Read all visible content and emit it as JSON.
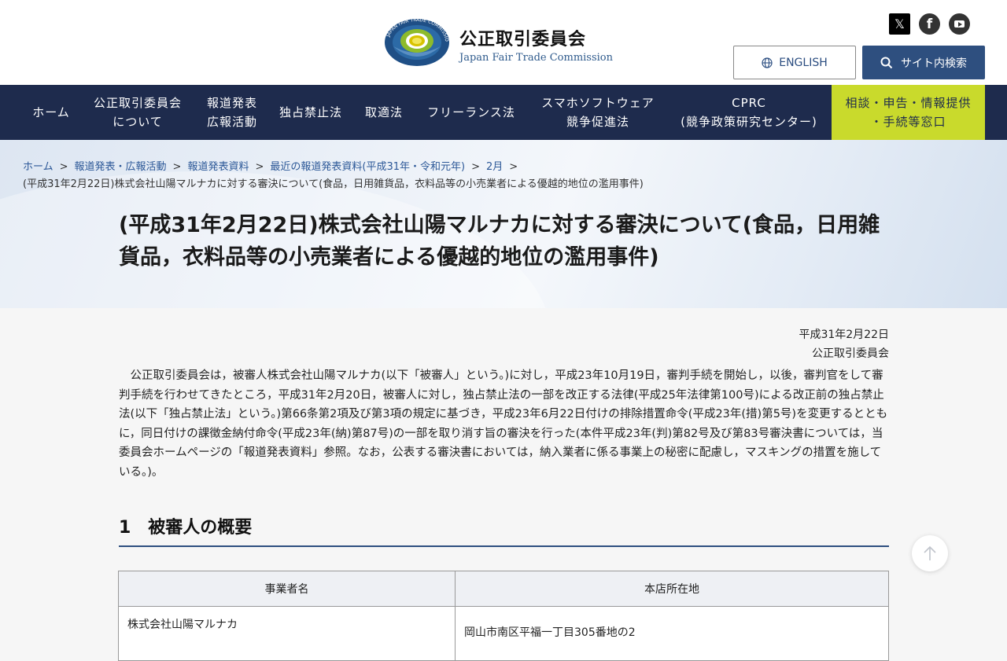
{
  "header": {
    "title": "公正取引委員会",
    "subtitle": "Japan Fair Trade Commission",
    "logo_ring_text": "JAPAN FAIR TRADE COMMISSION",
    "english_label": "ENGLISH",
    "search_label": "サイト内検索",
    "social": {
      "x": "𝕏",
      "facebook": "f"
    }
  },
  "nav": {
    "items": [
      {
        "label": "ホーム"
      },
      {
        "label": "公正取引委員会\nについて"
      },
      {
        "label": "報道発表\n広報活動"
      },
      {
        "label": "独占禁止法"
      },
      {
        "label": "取適法"
      },
      {
        "label": "フリーランス法"
      },
      {
        "label": "スマホソフトウェア\n競争促進法"
      },
      {
        "label": "CPRC\n(競争政策研究センター)"
      },
      {
        "label": "相談・申告・情報提供\n・手続等窓口"
      }
    ]
  },
  "breadcrumb": {
    "items": [
      "ホーム",
      "報道発表・広報活動",
      "報道発表資料",
      "最近の報道発表資料(平成31年・令和元年)",
      "2月"
    ],
    "separator": ">",
    "current": "(平成31年2月22日)株式会社山陽マルナカに対する審決について(食品，日用雑貨品，衣料品等の小売業者による優越的地位の濫用事件)"
  },
  "page": {
    "title": "(平成31年2月22日)株式会社山陽マルナカに対する審決について(食品，日用雑貨品，衣料品等の小売業者による優越的地位の濫用事件)",
    "date": "平成31年2月22日",
    "issuer": "公正取引委員会",
    "body": "公正取引委員会は，被審人株式会社山陽マルナカ(以下「被審人」という。)に対し，平成23年10月19日，審判手続を開始し，以後，審判官をして審判手続を行わせてきたところ，平成31年2月20日，被審人に対し，独占禁止法の一部を改正する法律(平成25年法律第100号)による改正前の独占禁止法(以下「独占禁止法」という。)第66条第2項及び第3項の規定に基づき，平成23年6月22日付けの排除措置命令(平成23年(措)第5号)を変更するとともに，同日付けの課徴金納付命令(平成23年(納)第87号)の一部を取り消す旨の審決を行った(本件平成23年(判)第82号及び第83号審決書については，当委員会ホームページの「報道発表資料」参照。なお，公表する審決書においては，納入業者に係る事業上の秘密に配慮し，マスキングの措置を施している。)。",
    "section1_title": "1　被審人の概要",
    "table": {
      "headers": [
        "事業者名",
        "本店所在地"
      ],
      "rows": [
        [
          "株式会社山陽マルナカ",
          "岡山市南区平福一丁目305番地の2"
        ]
      ]
    }
  },
  "colors": {
    "nav_bg": "#1e2b4d",
    "accent": "#2e4f7f",
    "consult_bg": "#c9da2c"
  }
}
